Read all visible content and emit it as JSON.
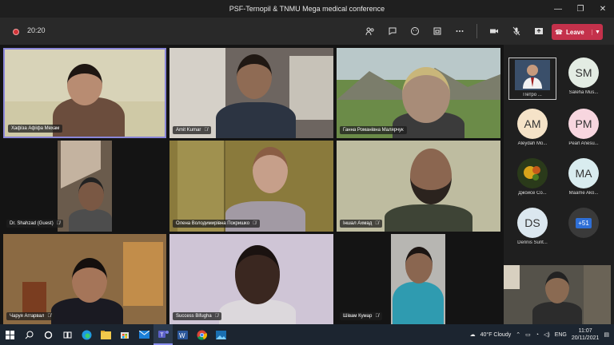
{
  "window": {
    "title": "PSF-Ternopil & TNMU Mega medical conference",
    "min": "—",
    "max": "❐",
    "close": "✕"
  },
  "toolbar": {
    "timer": "20:20",
    "leave_label": "Leave",
    "icons": [
      "people-icon",
      "chat-icon",
      "reactions-icon",
      "rooms-icon",
      "more-icon",
      "camera-icon",
      "mic-off-icon",
      "share-icon"
    ]
  },
  "participants": [
    {
      "name": "Хафіза Афіфа Мехам",
      "muted": false
    },
    {
      "name": "Amit Kumar",
      "muted": true
    },
    {
      "name": "Ганна Романівна Малярчук",
      "muted": false
    },
    {
      "name": "Dr. Shahzad (Guest)",
      "muted": true
    },
    {
      "name": "Олена Володимирівна Покришко",
      "muted": true
    },
    {
      "name": "Іншал Ахмад",
      "muted": true
    },
    {
      "name": "Чаруя Аггарвал",
      "muted": true
    },
    {
      "name": "Success Bifugha",
      "muted": true
    },
    {
      "name": "Шівам Кумар",
      "muted": true
    }
  ],
  "roster": [
    {
      "initials": "",
      "name": "Петро ...",
      "color": "#3a4f6a"
    },
    {
      "initials": "SM",
      "name": "Saleha Mus...",
      "color": "#e3ece3"
    },
    {
      "initials": "AM",
      "name": "Aleydah Mo...",
      "color": "#f5e3c8"
    },
    {
      "initials": "PM",
      "name": "Pearl Anesu...",
      "color": "#f7d6df"
    },
    {
      "initials": "",
      "name": "Джойсе Со...",
      "color": "#2a3a1a"
    },
    {
      "initials": "MA",
      "name": "Maame Ako...",
      "color": "#d9ecef"
    },
    {
      "initials": "DS",
      "name": "Dennis Sunt...",
      "color": "#dbe7ef"
    },
    {
      "initials": "+51",
      "name": "",
      "color": "#3a3a3a"
    }
  ],
  "taskbar": {
    "weather": "40°F  Cloudy",
    "lang": "ENG",
    "time": "11:07",
    "date": "20/11/2021"
  }
}
